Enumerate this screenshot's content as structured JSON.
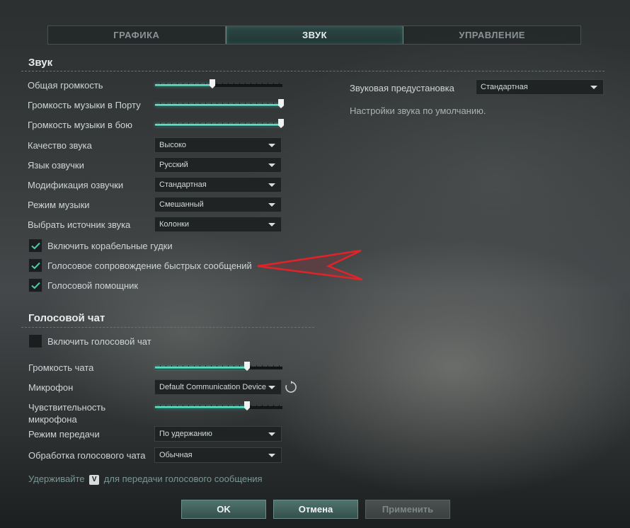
{
  "tabs": [
    {
      "label": "ГРАФИКА",
      "active": false
    },
    {
      "label": "ЗВУК",
      "active": true
    },
    {
      "label": "УПРАВЛЕНИЕ",
      "active": false
    }
  ],
  "sound": {
    "title": "Звук",
    "general_volume": {
      "label": "Общая громкость",
      "value": 0.45
    },
    "port_music_volume": {
      "label": "Громкость музыки в Порту",
      "value": 1.0
    },
    "battle_music_volume": {
      "label": "Громкость музыки в бою",
      "value": 1.0
    },
    "quality": {
      "label": "Качество звука",
      "value": "Высоко"
    },
    "voice_language": {
      "label": "Язык озвучки",
      "value": "Русский"
    },
    "voice_mod": {
      "label": "Модификация озвучки",
      "value": "Стандартная"
    },
    "music_mode": {
      "label": "Режим музыки",
      "value": "Смешанный"
    },
    "sound_source": {
      "label": "Выбрать источник звука",
      "value": "Колонки"
    },
    "ship_horns": {
      "label": "Включить корабельные гудки",
      "checked": true
    },
    "quick_messages_voice": {
      "label": "Голосовое сопровождение быстрых сообщений",
      "checked": true
    },
    "voice_assistant": {
      "label": "Голосовой помощник",
      "checked": true
    }
  },
  "preset": {
    "label": "Звуковая предустановка",
    "value": "Стандартная",
    "description": "Настройки звука по умолчанию."
  },
  "voice_chat": {
    "title": "Голосовой чат",
    "enable": {
      "label": "Включить голосовой чат",
      "checked": false
    },
    "chat_volume": {
      "label": "Громкость чата",
      "value": 0.72
    },
    "microphone": {
      "label": "Микрофон",
      "value": "Default Communication Device"
    },
    "mic_sensitivity": {
      "label_line1": "Чувствительность",
      "label_line2": "микрофона",
      "value": 0.72
    },
    "transmit_mode": {
      "label": "Режим передачи",
      "value": "По удержанию"
    },
    "processing": {
      "label": "Обработка голосового чата",
      "value": "Обычная"
    },
    "hint_before": "Удерживайте",
    "hint_key": "V",
    "hint_after": "для передачи голосового сообщения"
  },
  "buttons": {
    "ok": "OK",
    "cancel": "Отмена",
    "apply": "Применить"
  },
  "colors": {
    "accent": "#3fc9ad",
    "annotation_arrow": "#e0242a"
  },
  "icons": {
    "checkmark": "check-icon",
    "refresh": "refresh-icon",
    "dropdown": "chevron-down-icon"
  }
}
